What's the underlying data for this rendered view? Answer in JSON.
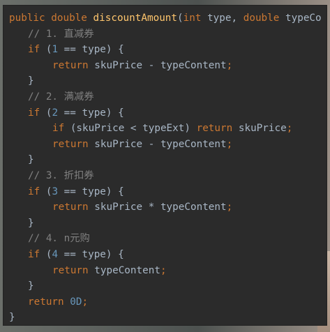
{
  "editor": {
    "lines": [
      {
        "indent": 0,
        "tokens": [
          {
            "t": "kw",
            "v": "public double "
          },
          {
            "t": "fn",
            "v": "discountAmount"
          },
          {
            "t": "pn",
            "v": "("
          },
          {
            "t": "kw",
            "v": "int "
          },
          {
            "t": "id",
            "v": "type, "
          },
          {
            "t": "kw",
            "v": "double "
          },
          {
            "t": "id",
            "v": "typeCo"
          }
        ]
      },
      {
        "indent": 1,
        "tokens": [
          {
            "t": "cm",
            "v": "// 1. "
          },
          {
            "t": "cm cjk",
            "v": "直减券"
          }
        ]
      },
      {
        "indent": 1,
        "tokens": [
          {
            "t": "kw",
            "v": "if "
          },
          {
            "t": "pn",
            "v": "("
          },
          {
            "t": "num",
            "v": "1"
          },
          {
            "t": "pn",
            "v": " == type) {"
          }
        ]
      },
      {
        "indent": 2,
        "tokens": [
          {
            "t": "kw",
            "v": "return "
          },
          {
            "t": "id",
            "v": "skuPrice - typeContent"
          },
          {
            "t": "kw",
            "v": ";"
          }
        ]
      },
      {
        "indent": 1,
        "tokens": [
          {
            "t": "pn",
            "v": "}"
          }
        ]
      },
      {
        "indent": 1,
        "tokens": [
          {
            "t": "cm",
            "v": "// 2. "
          },
          {
            "t": "cm cjk",
            "v": "满减券"
          }
        ]
      },
      {
        "indent": 1,
        "tokens": [
          {
            "t": "kw",
            "v": "if "
          },
          {
            "t": "pn",
            "v": "("
          },
          {
            "t": "num",
            "v": "2"
          },
          {
            "t": "pn",
            "v": " == type) {"
          }
        ]
      },
      {
        "indent": 2,
        "tokens": [
          {
            "t": "kw",
            "v": "if "
          },
          {
            "t": "pn",
            "v": "(skuPrice < typeExt) "
          },
          {
            "t": "kw",
            "v": "return "
          },
          {
            "t": "id",
            "v": "skuPrice"
          },
          {
            "t": "kw",
            "v": ";"
          }
        ]
      },
      {
        "indent": 2,
        "tokens": [
          {
            "t": "kw",
            "v": "return "
          },
          {
            "t": "id",
            "v": "skuPrice - typeContent"
          },
          {
            "t": "kw",
            "v": ";"
          }
        ]
      },
      {
        "indent": 1,
        "tokens": [
          {
            "t": "pn",
            "v": "}"
          }
        ]
      },
      {
        "indent": 1,
        "tokens": [
          {
            "t": "cm",
            "v": "// 3. "
          },
          {
            "t": "cm cjk",
            "v": "折扣券"
          }
        ]
      },
      {
        "indent": 1,
        "tokens": [
          {
            "t": "kw",
            "v": "if "
          },
          {
            "t": "pn",
            "v": "("
          },
          {
            "t": "num",
            "v": "3"
          },
          {
            "t": "pn",
            "v": " == type) {"
          }
        ]
      },
      {
        "indent": 2,
        "tokens": [
          {
            "t": "kw",
            "v": "return "
          },
          {
            "t": "id",
            "v": "skuPrice * typeContent"
          },
          {
            "t": "kw",
            "v": ";"
          }
        ]
      },
      {
        "indent": 1,
        "tokens": [
          {
            "t": "pn",
            "v": "}"
          }
        ]
      },
      {
        "indent": 1,
        "tokens": [
          {
            "t": "cm",
            "v": "// 4. n"
          },
          {
            "t": "cm cjk",
            "v": "元购"
          }
        ]
      },
      {
        "indent": 1,
        "tokens": [
          {
            "t": "kw",
            "v": "if "
          },
          {
            "t": "pn",
            "v": "("
          },
          {
            "t": "num",
            "v": "4"
          },
          {
            "t": "pn",
            "v": " == type) {"
          }
        ]
      },
      {
        "indent": 2,
        "tokens": [
          {
            "t": "kw",
            "v": "return "
          },
          {
            "t": "id",
            "v": "typeContent"
          },
          {
            "t": "kw",
            "v": ";"
          }
        ]
      },
      {
        "indent": 1,
        "tokens": [
          {
            "t": "pn",
            "v": "}"
          }
        ]
      },
      {
        "indent": 1,
        "tokens": [
          {
            "t": "kw",
            "v": "return "
          },
          {
            "t": "num",
            "v": "0D"
          },
          {
            "t": "kw",
            "v": ";"
          }
        ]
      },
      {
        "indent": 0,
        "tokens": [
          {
            "t": "pn",
            "v": "}"
          }
        ]
      }
    ]
  },
  "colors": {
    "editor_background": "#2b2b2b",
    "keyword": "#cc7832",
    "function": "#ffc66d",
    "number": "#6897bb",
    "comment": "#808080",
    "text": "#a9b7c6"
  }
}
